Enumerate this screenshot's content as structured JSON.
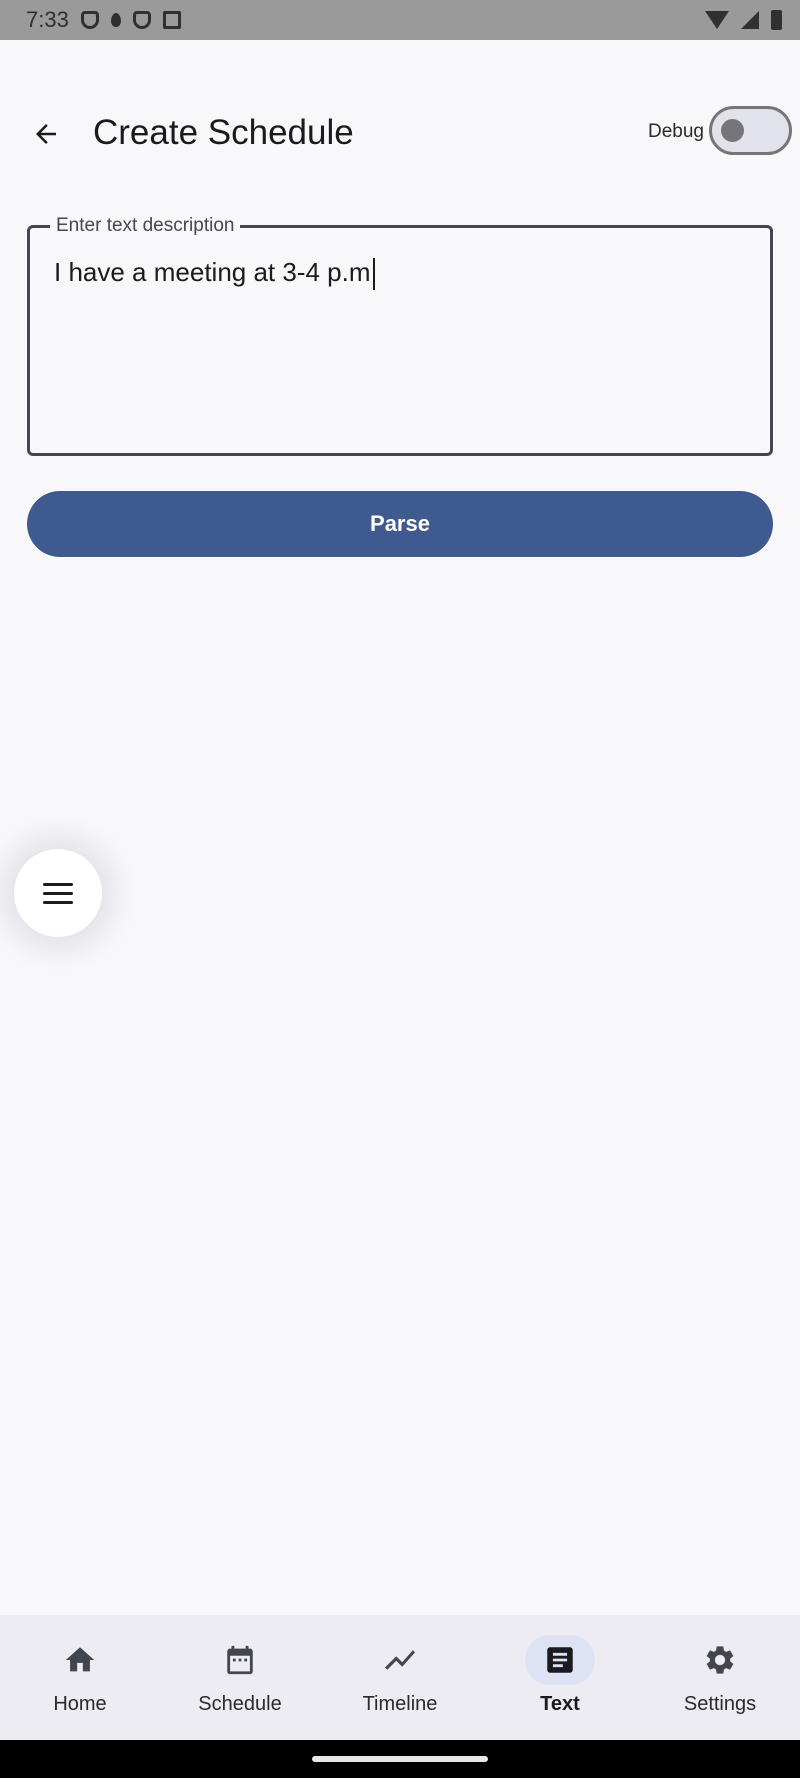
{
  "status_bar": {
    "time": "7:33",
    "left_icons": [
      "shield-icon",
      "drop-icon",
      "shield-icon",
      "box-icon"
    ],
    "right_icons": [
      "wifi-icon",
      "signal-icon",
      "battery-icon"
    ]
  },
  "app_bar": {
    "title": "Create Schedule",
    "back_icon": "arrow-back-icon",
    "debug_label": "Debug",
    "debug_enabled": false
  },
  "text_field": {
    "label": "Enter text description",
    "value": "I have a meeting at 3-4 p.m"
  },
  "parse_button": {
    "label": "Parse"
  },
  "fab": {
    "icon": "menu-icon"
  },
  "bottom_nav": {
    "active": "Text",
    "items": [
      {
        "label": "Home",
        "icon": "home-icon"
      },
      {
        "label": "Schedule",
        "icon": "calendar-icon"
      },
      {
        "label": "Timeline",
        "icon": "trend-icon"
      },
      {
        "label": "Text",
        "icon": "document-icon"
      },
      {
        "label": "Settings",
        "icon": "gear-icon"
      }
    ]
  },
  "colors": {
    "primary": "#3f5a8f",
    "background": "#f8f8fb",
    "nav_background": "#ececf2",
    "active_indicator": "#dde2f4"
  }
}
